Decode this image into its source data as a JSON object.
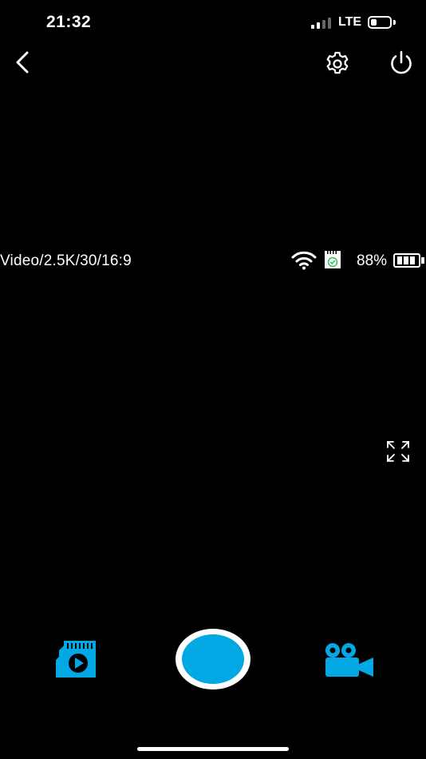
{
  "status_bar": {
    "time": "21:32",
    "network": "LTE",
    "signal_bars_active": 2,
    "signal_bars_total": 4,
    "battery_level_fraction": 0.3
  },
  "top_bar": {
    "back_icon": "chevron-left-icon",
    "settings_icon": "gear-icon",
    "power_icon": "power-icon"
  },
  "camera_info": {
    "mode_text": "Video/2.5K/30/16:9",
    "wifi_icon": "wifi-icon",
    "sd_card_icon": "sd-card-ok-icon",
    "battery_text": "88%",
    "battery_cells": 3
  },
  "preview": {
    "fullscreen_icon": "expand-icon"
  },
  "bottom_bar": {
    "gallery_icon": "sd-card-play-icon",
    "shutter": "record-button",
    "mode_icon": "video-camera-icon"
  },
  "colors": {
    "accent": "#02a8e4",
    "background": "#000000",
    "foreground": "#ffffff",
    "sd_ok": "#2ec45a"
  }
}
